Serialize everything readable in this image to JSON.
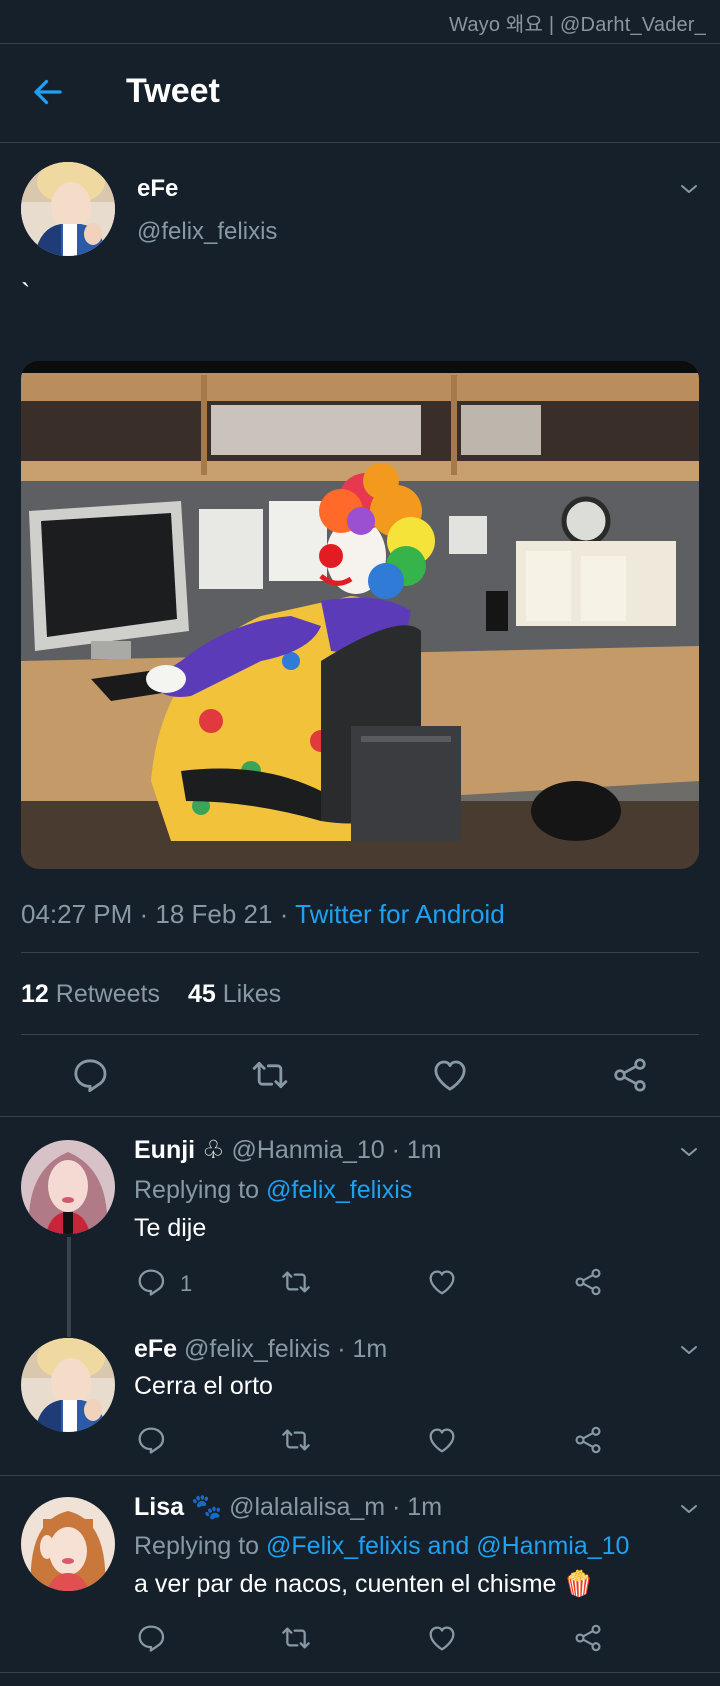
{
  "watermark": "Wayo 왜요 | @Darht_Vader_",
  "header": {
    "title": "Tweet"
  },
  "tweet": {
    "author_name": "eFe",
    "author_handle": "@felix_felixis",
    "text": "`",
    "time": "04:27 PM · 18 Feb 21 · ",
    "source": "Twitter for Android",
    "retweets_count": "12",
    "retweets_label": "Retweets",
    "likes_count": "45",
    "likes_label": "Likes"
  },
  "replies": [
    {
      "name": "Eunji",
      "badge": "♧",
      "meta": "@Hanmia_10 · 1m",
      "replying_prefix": "Replying to ",
      "replying_to": "@felix_felixis",
      "text": "Te dije",
      "reply_count": "1"
    },
    {
      "name": "eFe",
      "meta": "@felix_felixis · 1m",
      "text": "Cerra el orto"
    },
    {
      "name": "Lisa",
      "badge": "🐾",
      "meta": "@lalalalisa_m · 1m",
      "replying_prefix": "Replying to ",
      "replying_to": "@Felix_felixis and @Hanmia_10",
      "text": "a ver par de nacos, cuenten el chisme 🍿"
    }
  ],
  "colors": {
    "background": "#15202b",
    "accent": "#1da1f2",
    "muted": "#8899a6",
    "divider": "#38444d"
  },
  "icons": [
    "back-arrow-icon",
    "chevron-down-icon",
    "reply-icon",
    "retweet-icon",
    "like-icon",
    "share-icon"
  ]
}
